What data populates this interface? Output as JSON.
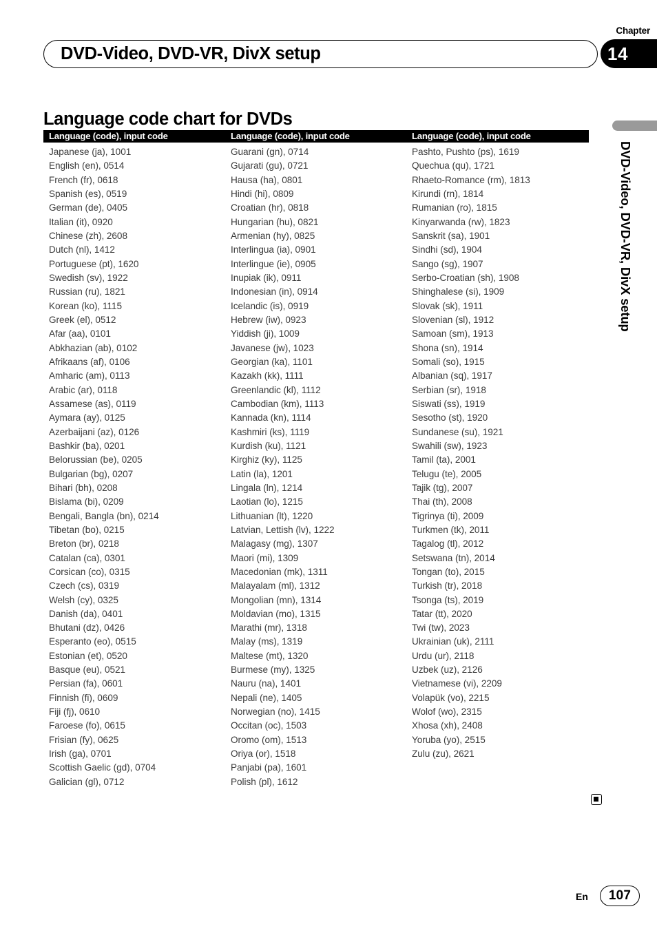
{
  "chapter": {
    "label": "Chapter",
    "number": "14"
  },
  "running_head": {
    "title": "DVD-Video, DVD-VR, DivX setup"
  },
  "section": {
    "heading": "Language code chart for DVDs"
  },
  "table": {
    "column_headers": [
      "Language (code), input code",
      "Language (code), input code",
      "Language (code), input code"
    ],
    "columns": [
      [
        "Japanese (ja), 1001",
        "English (en), 0514",
        "French (fr), 0618",
        "Spanish (es), 0519",
        "German (de), 0405",
        "Italian (it), 0920",
        "Chinese (zh), 2608",
        "Dutch (nl), 1412",
        "Portuguese (pt), 1620",
        "Swedish (sv), 1922",
        "Russian (ru), 1821",
        "Korean (ko), 1115",
        "Greek (el), 0512",
        "Afar (aa), 0101",
        "Abkhazian (ab), 0102",
        "Afrikaans (af), 0106",
        "Amharic (am), 0113",
        "Arabic (ar), 0118",
        "Assamese (as), 0119",
        "Aymara (ay), 0125",
        "Azerbaijani (az), 0126",
        "Bashkir (ba), 0201",
        "Belorussian (be), 0205",
        "Bulgarian (bg), 0207",
        "Bihari (bh), 0208",
        "Bislama (bi), 0209",
        "Bengali, Bangla (bn), 0214",
        "Tibetan (bo), 0215",
        "Breton (br), 0218",
        "Catalan (ca), 0301",
        "Corsican (co), 0315",
        "Czech (cs), 0319",
        "Welsh (cy), 0325",
        "Danish (da), 0401",
        "Bhutani (dz), 0426",
        "Esperanto (eo), 0515",
        "Estonian (et), 0520",
        "Basque (eu), 0521",
        "Persian (fa), 0601",
        "Finnish (fi), 0609",
        "Fiji (fj), 0610",
        "Faroese (fo), 0615",
        "Frisian (fy), 0625",
        "Irish (ga), 0701",
        "Scottish Gaelic (gd), 0704",
        "Galician (gl), 0712"
      ],
      [
        "Guarani (gn), 0714",
        "Gujarati (gu), 0721",
        "Hausa (ha), 0801",
        "Hindi (hi), 0809",
        "Croatian (hr), 0818",
        "Hungarian (hu), 0821",
        "Armenian (hy), 0825",
        "Interlingua (ia), 0901",
        "Interlingue (ie), 0905",
        "Inupiak (ik), 0911",
        "Indonesian (in), 0914",
        "Icelandic (is), 0919",
        "Hebrew (iw), 0923",
        "Yiddish (ji), 1009",
        "Javanese (jw), 1023",
        "Georgian (ka), 1101",
        "Kazakh (kk), 1111",
        "Greenlandic (kl), 1112",
        "Cambodian (km), 1113",
        "Kannada (kn), 1114",
        "Kashmiri (ks), 1119",
        "Kurdish (ku), 1121",
        "Kirghiz (ky), 1125",
        "Latin (la), 1201",
        "Lingala (ln), 1214",
        "Laotian (lo), 1215",
        "Lithuanian (lt), 1220",
        "Latvian, Lettish (lv), 1222",
        "Malagasy (mg), 1307",
        "Maori (mi), 1309",
        "Macedonian (mk), 1311",
        "Malayalam (ml), 1312",
        "Mongolian (mn), 1314",
        "Moldavian (mo), 1315",
        "Marathi (mr), 1318",
        "Malay (ms), 1319",
        "Maltese (mt), 1320",
        "Burmese (my), 1325",
        "Nauru (na), 1401",
        "Nepali (ne), 1405",
        "Norwegian (no), 1415",
        "Occitan (oc), 1503",
        "Oromo (om), 1513",
        "Oriya (or), 1518",
        "Panjabi (pa), 1601",
        "Polish (pl), 1612"
      ],
      [
        "Pashto, Pushto (ps), 1619",
        "Quechua (qu), 1721",
        "Rhaeto-Romance (rm), 1813",
        "Kirundi (rn), 1814",
        "Rumanian (ro), 1815",
        "Kinyarwanda (rw), 1823",
        "Sanskrit (sa), 1901",
        "Sindhi (sd), 1904",
        "Sango (sg), 1907",
        "Serbo-Croatian (sh), 1908",
        "Shinghalese (si), 1909",
        "Slovak (sk), 1911",
        "Slovenian (sl), 1912",
        "Samoan (sm), 1913",
        "Shona (sn), 1914",
        "Somali (so), 1915",
        "Albanian (sq), 1917",
        "Serbian (sr), 1918",
        "Siswati (ss), 1919",
        "Sesotho (st), 1920",
        "Sundanese (su), 1921",
        "Swahili (sw), 1923",
        "Tamil (ta), 2001",
        "Telugu (te), 2005",
        "Tajik (tg), 2007",
        "Thai (th), 2008",
        "Tigrinya (ti), 2009",
        "Turkmen (tk), 2011",
        "Tagalog (tl), 2012",
        "Setswana (tn), 2014",
        "Tongan (to), 2015",
        "Turkish (tr), 2018",
        "Tsonga (ts), 2019",
        "Tatar (tt), 2020",
        "Twi (tw), 2023",
        "Ukrainian (uk), 2111",
        "Urdu (ur), 2118",
        "Uzbek (uz), 2126",
        "Vietnamese (vi), 2209",
        "Volapük (vo), 2215",
        "Wolof (wo), 2315",
        "Xhosa (xh), 2408",
        "Yoruba (yo), 2515",
        "Zulu (zu), 2621"
      ]
    ]
  },
  "side_tab": {
    "text": "DVD-Video, DVD-VR, DivX setup"
  },
  "footer": {
    "language": "En",
    "page_number": "107"
  },
  "colors": {
    "header_band": "#000000",
    "body_text": "#3a3a3a",
    "side_tab_bar": "#9a9a9a"
  }
}
